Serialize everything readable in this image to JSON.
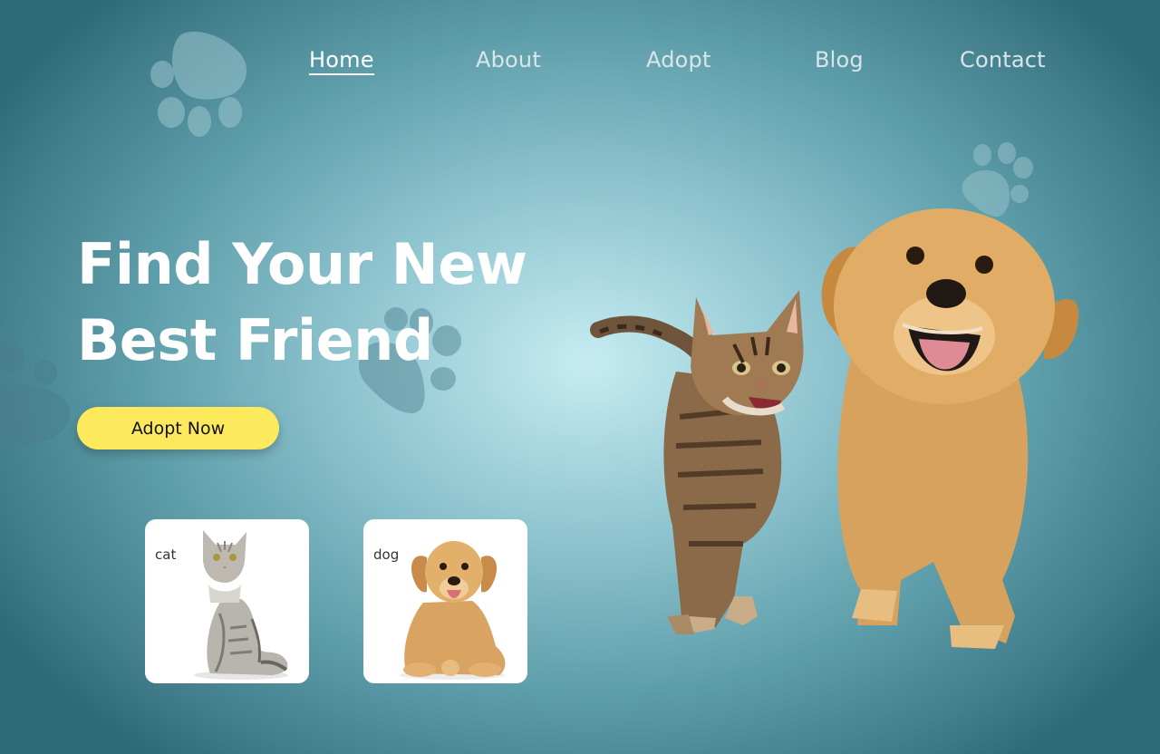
{
  "nav": {
    "items": [
      {
        "label": "Home",
        "active": true
      },
      {
        "label": "About",
        "active": false
      },
      {
        "label": "Adopt",
        "active": false
      },
      {
        "label": "Blog",
        "active": false
      },
      {
        "label": "Contact",
        "active": false
      }
    ]
  },
  "hero": {
    "title_line1": "Find Your New",
    "title_line2": "Best Friend",
    "cta_label": "Adopt Now"
  },
  "cards": [
    {
      "label": "cat",
      "image": "cat-photo"
    },
    {
      "label": "dog",
      "image": "dog-photo"
    }
  ],
  "hero_image": "kitten-and-puppy-running",
  "colors": {
    "accent": "#fde95c",
    "background_center": "#c6ecf1",
    "background_edge": "#2f6a79",
    "text": "#ffffff"
  },
  "icons": [
    "paw-icon"
  ]
}
